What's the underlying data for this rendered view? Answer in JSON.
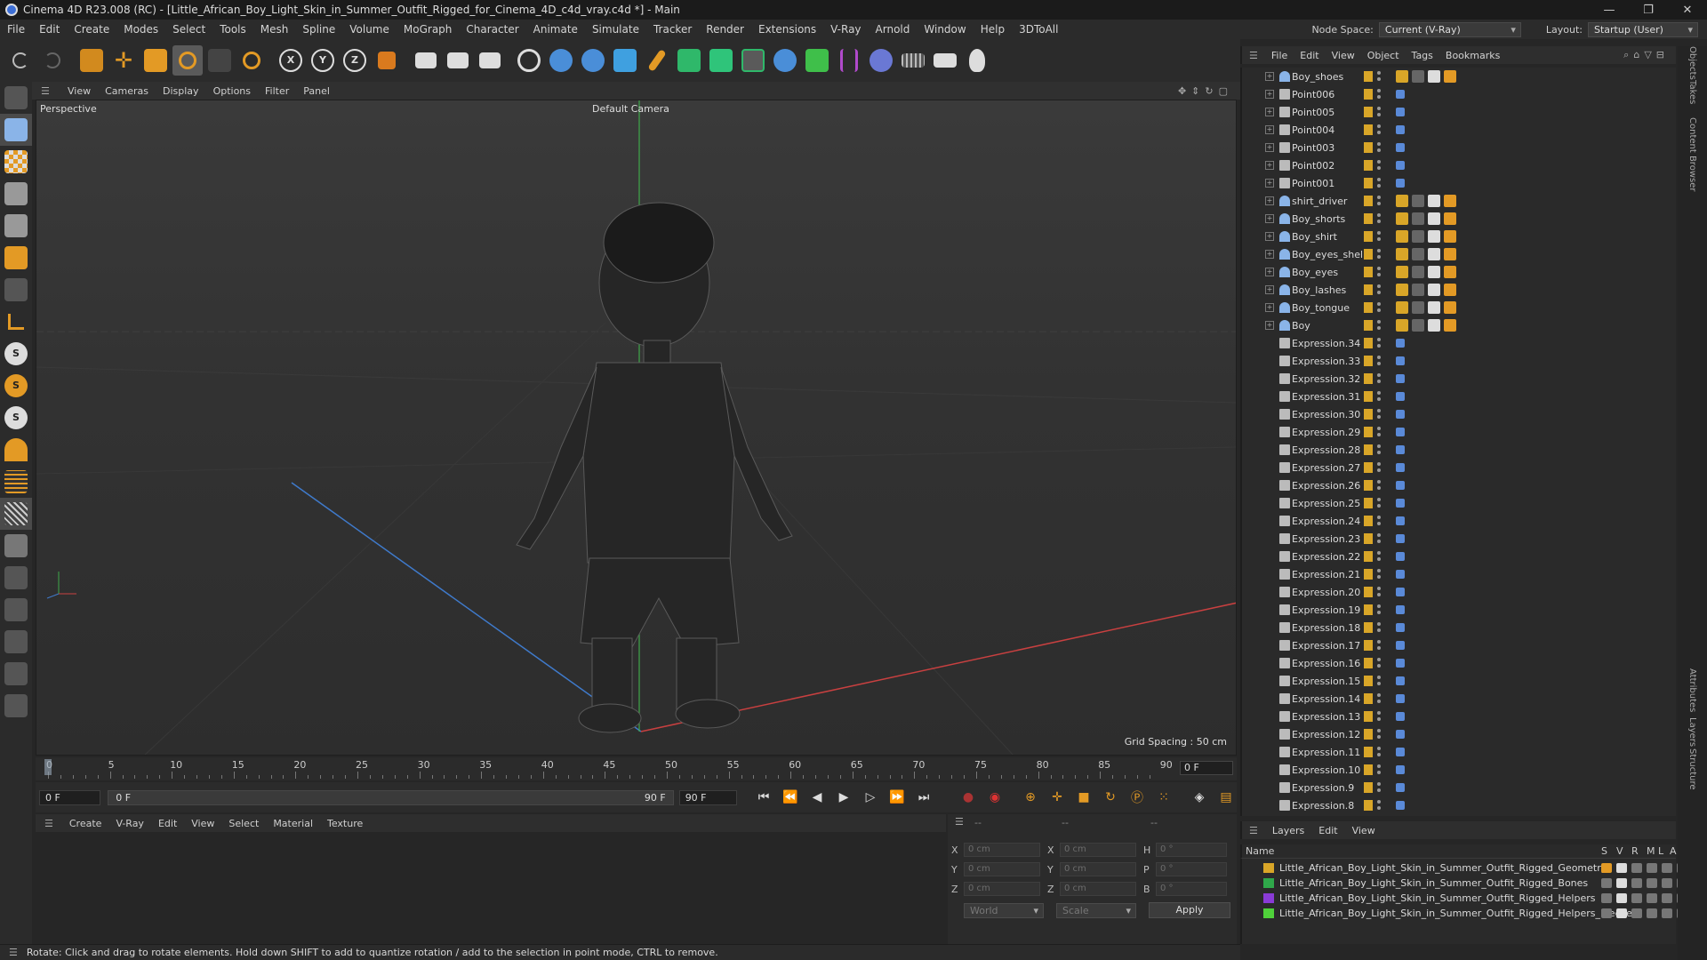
{
  "window": {
    "title": "Cinema 4D R23.008 (RC) - [Little_African_Boy_Light_Skin_in_Summer_Outfit_Rigged_for_Cinema_4D_c4d_vray.c4d *] - Main"
  },
  "menu": [
    "File",
    "Edit",
    "Create",
    "Modes",
    "Select",
    "Tools",
    "Mesh",
    "Spline",
    "Volume",
    "MoGraph",
    "Character",
    "Animate",
    "Simulate",
    "Tracker",
    "Render",
    "Extensions",
    "V-Ray",
    "Arnold",
    "Window",
    "Help",
    "3DToAll"
  ],
  "nodespace": {
    "label": "Node Space:",
    "value": "Current (V-Ray)"
  },
  "layout": {
    "label": "Layout:",
    "value": "Startup (User)"
  },
  "viewport": {
    "menu": [
      "View",
      "Cameras",
      "Display",
      "Options",
      "Filter",
      "Panel"
    ],
    "label": "Perspective",
    "camera": "Default Camera",
    "grid_spacing": "Grid Spacing : 50 cm"
  },
  "timeline": {
    "ticks": [
      "0",
      "5",
      "10",
      "15",
      "20",
      "25",
      "30",
      "35",
      "40",
      "45",
      "50",
      "55",
      "60",
      "65",
      "70",
      "75",
      "80",
      "85",
      "90"
    ],
    "current_frame": "0 F",
    "start": "0 F",
    "range_start": "0 F",
    "range_end": "90 F",
    "end": "90 F"
  },
  "material": {
    "menu": [
      "Create",
      "V-Ray",
      "Edit",
      "View",
      "Select",
      "Material",
      "Texture"
    ]
  },
  "coords": {
    "header_left": "--",
    "header_mid": "--",
    "header_right": "--",
    "rows": [
      {
        "l1": "X",
        "v1": "0 cm",
        "l2": "X",
        "v2": "0 cm",
        "l3": "H",
        "v3": "0 °"
      },
      {
        "l1": "Y",
        "v1": "0 cm",
        "l2": "Y",
        "v2": "0 cm",
        "l3": "P",
        "v3": "0 °"
      },
      {
        "l1": "Z",
        "v1": "0 cm",
        "l2": "Z",
        "v2": "0 cm",
        "l3": "B",
        "v3": "0 °"
      }
    ],
    "mode": "World",
    "scale": "Scale",
    "apply": "Apply"
  },
  "status": "Rotate: Click and drag to rotate elements. Hold down SHIFT to add to quantize rotation / add to the selection in point mode, CTRL to remove.",
  "objects": {
    "menu": [
      "File",
      "Edit",
      "View",
      "Object",
      "Tags",
      "Bookmarks"
    ],
    "items": [
      "Boy_shoes",
      "Point006",
      "Point005",
      "Point004",
      "Point003",
      "Point002",
      "Point001",
      "shirt_driver",
      "Boy_shorts",
      "Boy_shirt",
      "Boy_eyes_shell",
      "Boy_eyes",
      "Boy_lashes",
      "Boy_tongue",
      "Boy",
      "Expression.34",
      "Expression.33",
      "Expression.32",
      "Expression.31",
      "Expression.30",
      "Expression.29",
      "Expression.28",
      "Expression.27",
      "Expression.26",
      "Expression.25",
      "Expression.24",
      "Expression.23",
      "Expression.22",
      "Expression.21",
      "Expression.20",
      "Expression.19",
      "Expression.18",
      "Expression.17",
      "Expression.16",
      "Expression.15",
      "Expression.14",
      "Expression.13",
      "Expression.12",
      "Expression.11",
      "Expression.10",
      "Expression.9",
      "Expression.8"
    ]
  },
  "layers": {
    "menu": [
      "Layers",
      "Edit",
      "View"
    ],
    "header": {
      "name": "Name",
      "cols": [
        "S",
        "V",
        "R",
        "M",
        "L",
        "A"
      ]
    },
    "items": [
      {
        "name": "Little_African_Boy_Light_Skin_in_Summer_Outfit_Rigged_Geometry",
        "color": "#d9a628"
      },
      {
        "name": "Little_African_Boy_Light_Skin_in_Summer_Outfit_Rigged_Bones",
        "color": "#2fa84a"
      },
      {
        "name": "Little_African_Boy_Light_Skin_in_Summer_Outfit_Rigged_Helpers",
        "color": "#8a3bd6"
      },
      {
        "name": "Little_African_Boy_Light_Skin_in_Summer_Outfit_Rigged_Helpers_Freeze",
        "color": "#4fd13a"
      }
    ]
  },
  "right_tabs": [
    "Objects",
    "Takes",
    "Content Browser",
    "Attributes",
    "Layers",
    "Structure"
  ]
}
